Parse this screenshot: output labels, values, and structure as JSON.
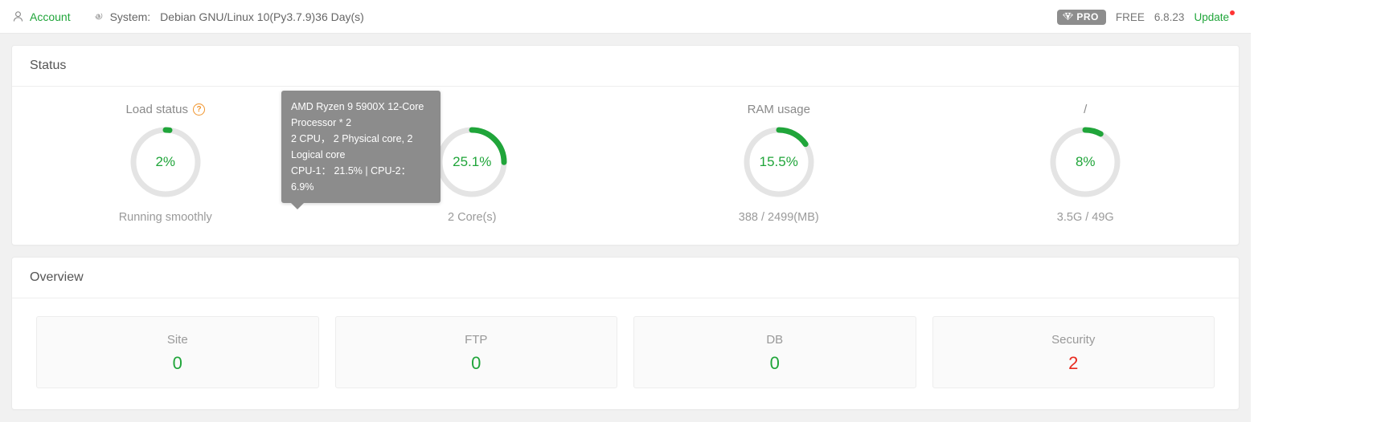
{
  "topbar": {
    "account_label": "Account",
    "account_icon": "user-icon",
    "system_icon": "debian-logo-icon",
    "system_label": "System:",
    "system_value": "Debian GNU/Linux 10(Py3.7.9)36 Day(s)",
    "pro_badge": "PRO",
    "pro_icon": "gem-icon",
    "license": "FREE",
    "version": "6.8.23",
    "update_label": "Update",
    "update_has_new": true
  },
  "status_card": {
    "title": "Status",
    "gauges": [
      {
        "label": "Load status",
        "has_help_icon": true,
        "value_text": "2%",
        "percent": 2,
        "sub": "Running smoothly",
        "color": "#20a53a"
      },
      {
        "label": "",
        "has_help_icon": false,
        "value_text": "25.1%",
        "percent": 25.1,
        "sub": "2 Core(s)",
        "color": "#20a53a"
      },
      {
        "label": "RAM usage",
        "has_help_icon": false,
        "value_text": "15.5%",
        "percent": 15.5,
        "sub": "388 / 2499(MB)",
        "color": "#20a53a"
      },
      {
        "label": "/",
        "has_help_icon": false,
        "value_text": "8%",
        "percent": 8,
        "sub": "3.5G / 49G",
        "color": "#20a53a"
      }
    ],
    "tooltip": {
      "line1": "AMD Ryzen 9 5900X 12-Core Processor * 2",
      "line2": "2 CPU， 2 Physical core, 2 Logical core",
      "line3": "CPU-1： 21.5% | CPU-2： 6.9%"
    }
  },
  "overview_card": {
    "title": "Overview",
    "stats": [
      {
        "name": "Site",
        "value": "0",
        "color": "#20a53a"
      },
      {
        "name": "FTP",
        "value": "0",
        "color": "#20a53a"
      },
      {
        "name": "DB",
        "value": "0",
        "color": "#20a53a"
      },
      {
        "name": "Security",
        "value": "2",
        "color": "#e82b1f"
      }
    ]
  },
  "colors": {
    "accent_green": "#20a53a",
    "danger_red": "#e82b1f",
    "ring_track": "#e4e4e4",
    "tooltip_bg": "#8c8c8c",
    "page_bg": "#f1f1f1"
  }
}
